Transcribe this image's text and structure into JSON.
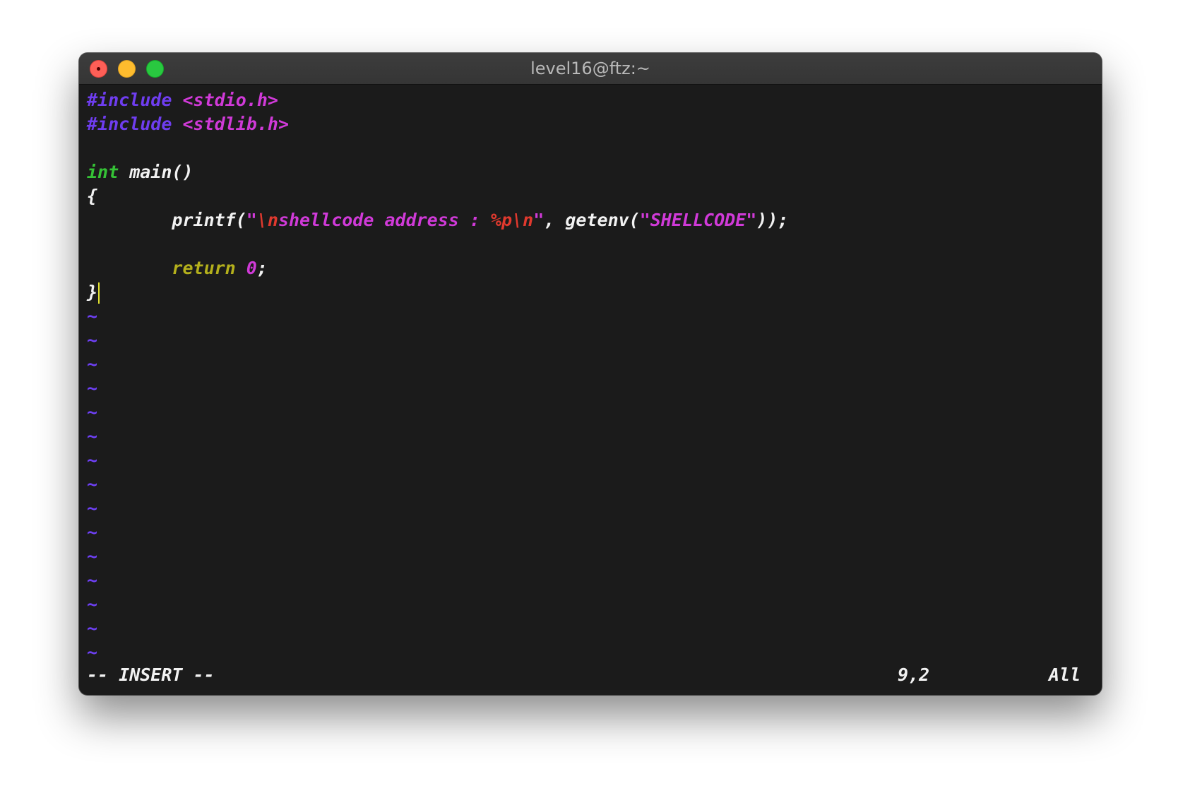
{
  "window": {
    "title": "level16@ftz:~"
  },
  "code": {
    "line1": {
      "directive": "#include",
      "space": " ",
      "header": "<stdio.h>"
    },
    "line2": {
      "directive": "#include",
      "space": " ",
      "header": "<stdlib.h>"
    },
    "line4": {
      "type": "int",
      "rest": " main()"
    },
    "line5": {
      "text": "{"
    },
    "line6": {
      "indent": "        ",
      "fn": "printf(",
      "q1": "\"",
      "esc1": "\\n",
      "str1": "shellcode address : ",
      "fmt": "%p",
      "esc2": "\\n",
      "q2": "\"",
      "mid": ", getenv(",
      "str2": "\"SHELLCODE\"",
      "end": "));"
    },
    "line8": {
      "indent": "        ",
      "kw": "return",
      "space": " ",
      "num": "0",
      "semi": ";"
    },
    "line9": {
      "text": "}"
    },
    "tilde": "~"
  },
  "status": {
    "mode": "-- INSERT --",
    "position": "9,2",
    "scroll": "All"
  },
  "colors": {
    "background": "#1b1b1b",
    "preproc": "#6f3df0",
    "string": "#d03ad8",
    "escape": "#e0392e",
    "type": "#35c236",
    "statement": "#b4b01c",
    "cursor": "#e3e331"
  }
}
